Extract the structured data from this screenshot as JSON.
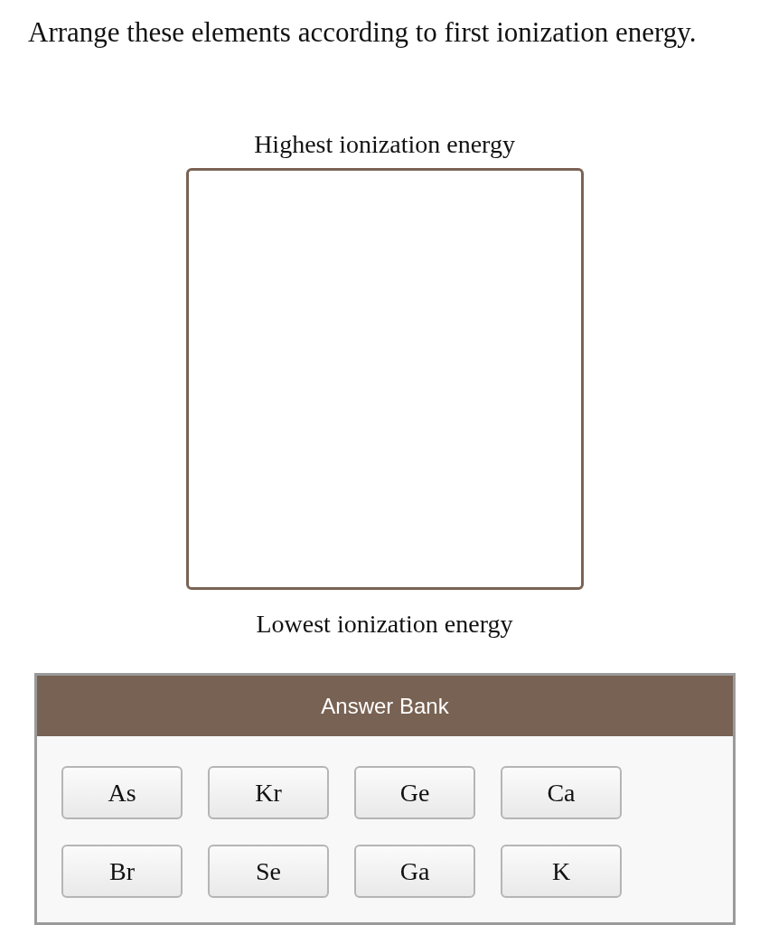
{
  "question": "Arrange these elements according to first ionization energy.",
  "ranking": {
    "top_label": "Highest ionization energy",
    "bottom_label": "Lowest ionization energy"
  },
  "answer_bank": {
    "title": "Answer Bank",
    "items": [
      {
        "label": "As"
      },
      {
        "label": "Kr"
      },
      {
        "label": "Ge"
      },
      {
        "label": "Ca"
      },
      {
        "label": "Br"
      },
      {
        "label": "Se"
      },
      {
        "label": "Ga"
      },
      {
        "label": "K"
      }
    ]
  }
}
